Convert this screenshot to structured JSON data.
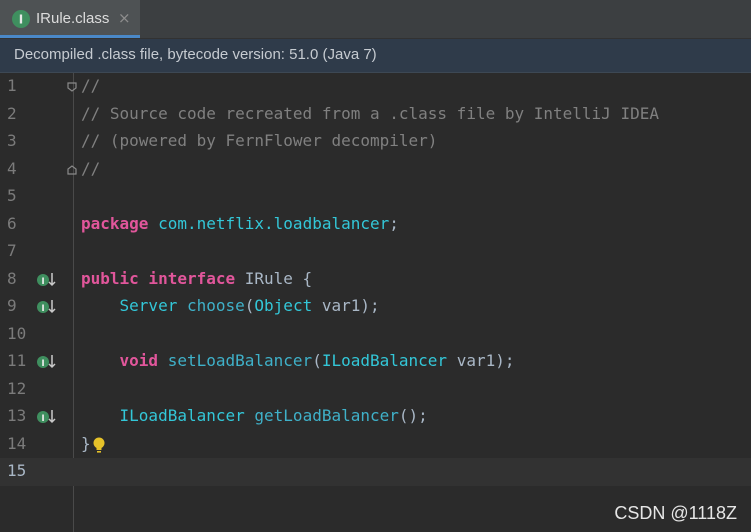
{
  "tab": {
    "label": "IRule.class",
    "close": "×",
    "icon": "interface-icon",
    "icon_letter": "I"
  },
  "banner": {
    "text": "Decompiled .class file, bytecode version: 51.0 (Java 7)"
  },
  "lines": [
    {
      "n": "1"
    },
    {
      "n": "2"
    },
    {
      "n": "3"
    },
    {
      "n": "4"
    },
    {
      "n": "5"
    },
    {
      "n": "6"
    },
    {
      "n": "7"
    },
    {
      "n": "8"
    },
    {
      "n": "9"
    },
    {
      "n": "10"
    },
    {
      "n": "11"
    },
    {
      "n": "12"
    },
    {
      "n": "13"
    },
    {
      "n": "14"
    },
    {
      "n": "15"
    }
  ],
  "code": {
    "l1": "//",
    "l2": "// Source code recreated from a .class file by IntelliJ IDEA",
    "l3": "// (powered by FernFlower decompiler)",
    "l4": "//",
    "l6_kw": "package",
    "l6_pkg": " com.netflix.loadbalancer",
    "l6_end": ";",
    "l8_kw1": "public",
    "l8_kw2": " interface",
    "l8_name": " IRule {",
    "l9_type": "    Server",
    "l9_method": " choose",
    "l9_open": "(",
    "l9_ptype": "Object",
    "l9_rest": " var1);",
    "l11_kw": "    void",
    "l11_method": " setLoadBalancer",
    "l11_open": "(",
    "l11_ptype": "ILoadBalancer",
    "l11_rest": " var1);",
    "l13_type": "    ILoadBalancer",
    "l13_method": " getLoadBalancer",
    "l13_rest": "();",
    "l14": "}"
  },
  "watermark": "CSDN @1118Z",
  "colors": {
    "keyword": "#e1569b",
    "type": "#33c7d8",
    "comment": "#808080",
    "accent": "#4a88c7"
  }
}
